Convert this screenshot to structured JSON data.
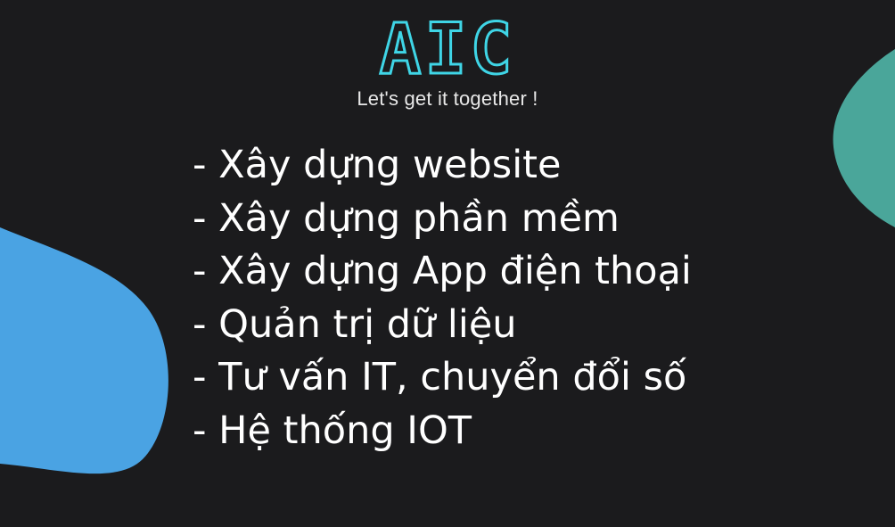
{
  "brand": {
    "logo_text": "AIC",
    "tagline": "Let's get it together !",
    "logo_color": "#3fd5e6"
  },
  "services": [
    "- Xây dựng website",
    "- Xây dựng phần mềm",
    "- Xây dựng App điện thoại",
    "- Quản trị dữ liệu",
    "- Tư vấn IT, chuyển đổi số",
    "- Hệ thống IOT"
  ],
  "colors": {
    "background": "#1b1b1d",
    "blob_left": "#4aa3e3",
    "blob_right": "#4aa69a",
    "text": "#ffffff"
  }
}
